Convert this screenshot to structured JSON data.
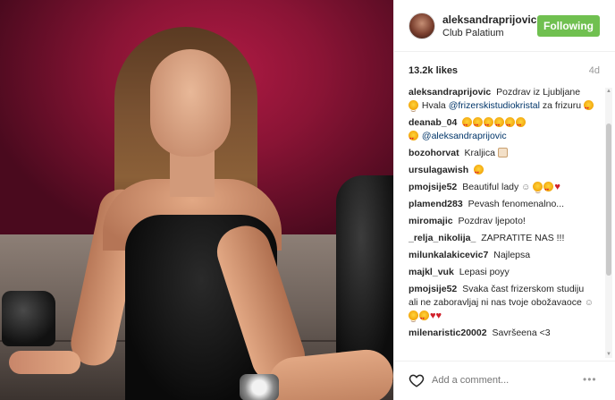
{
  "post": {
    "username": "aleksandraprijovic",
    "location": "Club Palatium",
    "follow_label": "Following",
    "likes": "13.2k likes",
    "age": "4d"
  },
  "comments": [
    {
      "author": "aleksandraprijovic",
      "text_before": "Pozdrav iz Ljubljane",
      "emoji1": "wink",
      "text_mid": "Hvala",
      "mention": "@frizerskistudiokristal",
      "text_after": "za frizuru",
      "emoji2": "heart-eyes"
    },
    {
      "author": "deanab_04",
      "mention": "@aleksandraprijovic"
    },
    {
      "author": "bozohorvat",
      "text": "Kraljica"
    },
    {
      "author": "ursulagawish"
    },
    {
      "author": "pmojsije52",
      "text": "Beautiful lady"
    },
    {
      "author": "plamend283",
      "text": "Pevash fenomenalno..."
    },
    {
      "author": "miromajic",
      "text": "Pozdrav ljepoto!"
    },
    {
      "author": "_relja_nikolija_",
      "text": "ZAPRATITE NAS !!!"
    },
    {
      "author": "milunkalakicevic7",
      "text": "Najlepsa"
    },
    {
      "author": "majkl_vuk",
      "text": "Lepasi poyy"
    },
    {
      "author": "pmojsije52",
      "text": "Svaka čast frizerskom studiju ali ne zaboravljaj ni nas tvoje obožavaoce"
    },
    {
      "author": "milenaristic20002",
      "text": "Savršeena <3"
    }
  ],
  "footer": {
    "comment_placeholder": "Add a comment...",
    "more_label": "•••"
  },
  "icons": {
    "like": "heart-outline-icon",
    "more": "more-options-icon"
  },
  "colors": {
    "follow_button": "#70c050",
    "mention": "#003569",
    "heart": "#d0202a"
  }
}
